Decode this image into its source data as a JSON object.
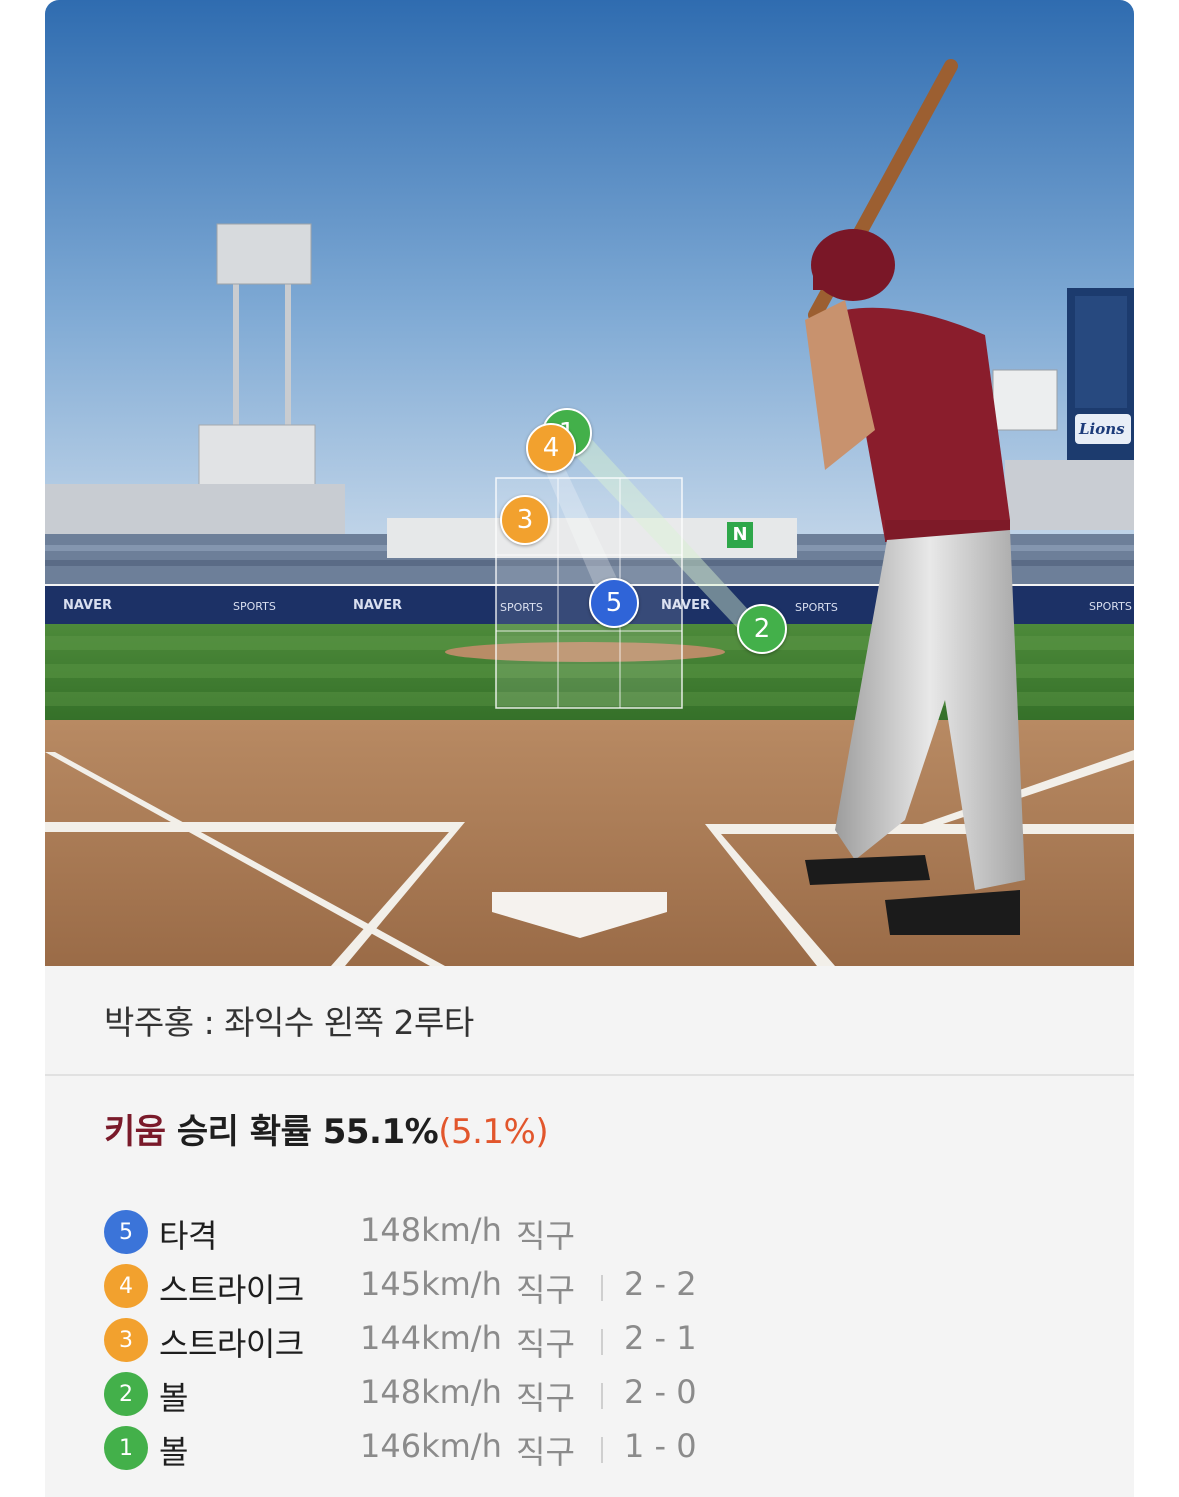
{
  "pitch_markers": [
    {
      "num": "1",
      "result": "볼",
      "color": "#43b04a"
    },
    {
      "num": "2",
      "result": "볼",
      "color": "#43b04a"
    },
    {
      "num": "3",
      "result": "스트라이크",
      "color": "#f2a12e"
    },
    {
      "num": "4",
      "result": "스트라이크",
      "color": "#f2a12e"
    },
    {
      "num": "5",
      "result": "타격",
      "color": "#2f64d8"
    }
  ],
  "stadium_ads": {
    "naver_1": "NAVER",
    "naver_2": "NAVER",
    "naver_3": "NAVER",
    "sports_1": "SPORTS",
    "sports_2": "SPORTS",
    "sports_3": "SPORTS",
    "sports_4": "SPORTS",
    "n_logo": "N",
    "lions": "Lions"
  },
  "play": {
    "description": "박주홍 : 좌익수 왼쪽 2루타"
  },
  "win_probability": {
    "team": "키움",
    "label": "승리 확률",
    "value": "55.1%",
    "delta": "(5.1%)",
    "team_color": "#7a1a2a",
    "delta_color": "#e2562c"
  },
  "pitches": [
    {
      "num": "5",
      "result": "타격",
      "speed": "148km/h",
      "type": "직구",
      "count": "",
      "color": "#3b74d9"
    },
    {
      "num": "4",
      "result": "스트라이크",
      "speed": "145km/h",
      "type": "직구",
      "count": "2 - 2",
      "color": "#f2a12e"
    },
    {
      "num": "3",
      "result": "스트라이크",
      "speed": "144km/h",
      "type": "직구",
      "count": "2 - 1",
      "color": "#f2a12e"
    },
    {
      "num": "2",
      "result": "볼",
      "speed": "148km/h",
      "type": "직구",
      "count": "2 - 0",
      "color": "#43b04a"
    },
    {
      "num": "1",
      "result": "볼",
      "speed": "146km/h",
      "type": "직구",
      "count": "1 - 0",
      "color": "#43b04a"
    }
  ]
}
